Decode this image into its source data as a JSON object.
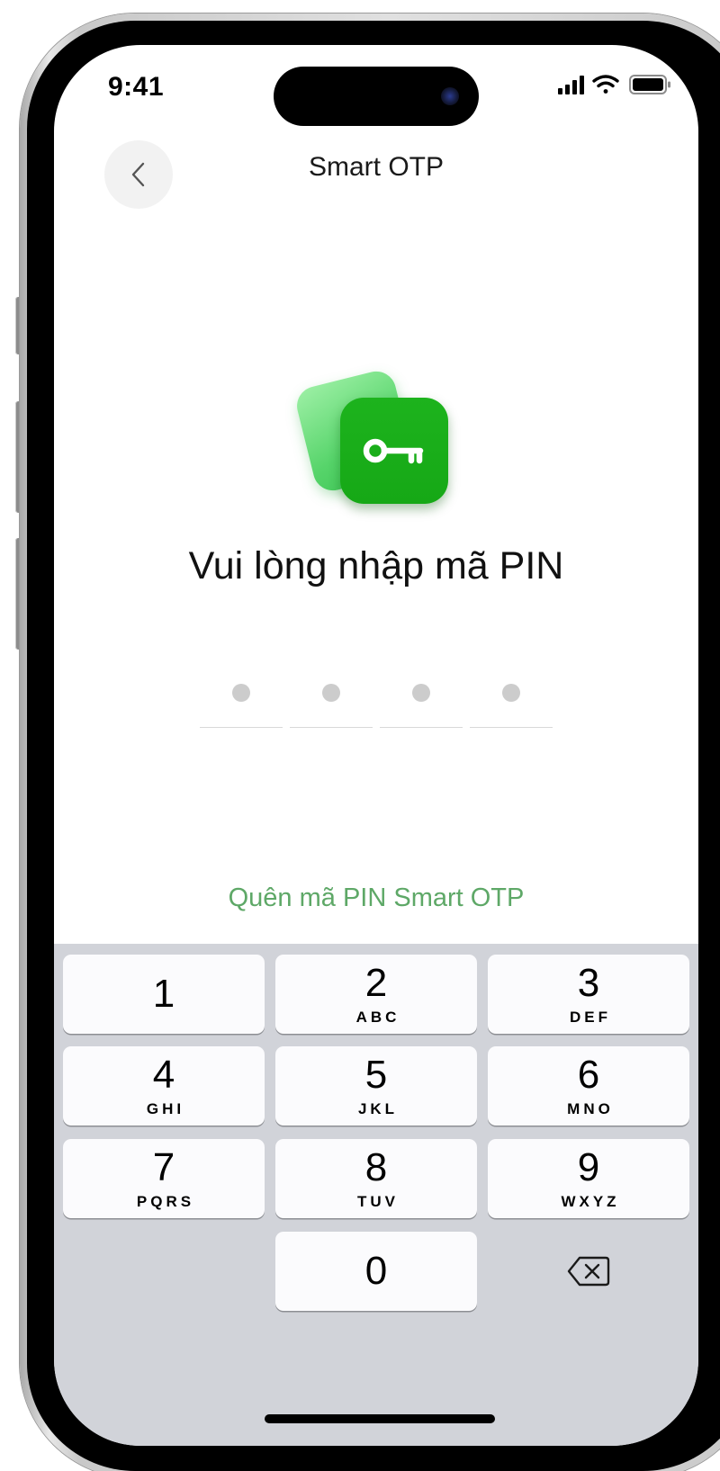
{
  "status_bar": {
    "time": "9:41"
  },
  "header": {
    "title": "Smart OTP",
    "back_icon": "chevron-left-icon"
  },
  "illustration": {
    "icon": "key-icon",
    "front_color": "#18ac18",
    "back_color": "#7be38a"
  },
  "pin": {
    "heading": "Vui lòng nhập mã PIN",
    "length": 4,
    "entered": 0
  },
  "forgot_link": "Quên mã PIN Smart OTP",
  "keypad": {
    "keys": [
      {
        "digit": "1",
        "letters": ""
      },
      {
        "digit": "2",
        "letters": "ABC"
      },
      {
        "digit": "3",
        "letters": "DEF"
      },
      {
        "digit": "4",
        "letters": "GHI"
      },
      {
        "digit": "5",
        "letters": "JKL"
      },
      {
        "digit": "6",
        "letters": "MNO"
      },
      {
        "digit": "7",
        "letters": "PQRS"
      },
      {
        "digit": "8",
        "letters": "TUV"
      },
      {
        "digit": "9",
        "letters": "WXYZ"
      },
      {
        "digit": "0",
        "letters": ""
      }
    ],
    "delete_icon": "backspace-icon"
  },
  "colors": {
    "accent_green": "#5ea867",
    "keypad_background": "#d1d3d9",
    "key_background": "#fbfbfd"
  }
}
